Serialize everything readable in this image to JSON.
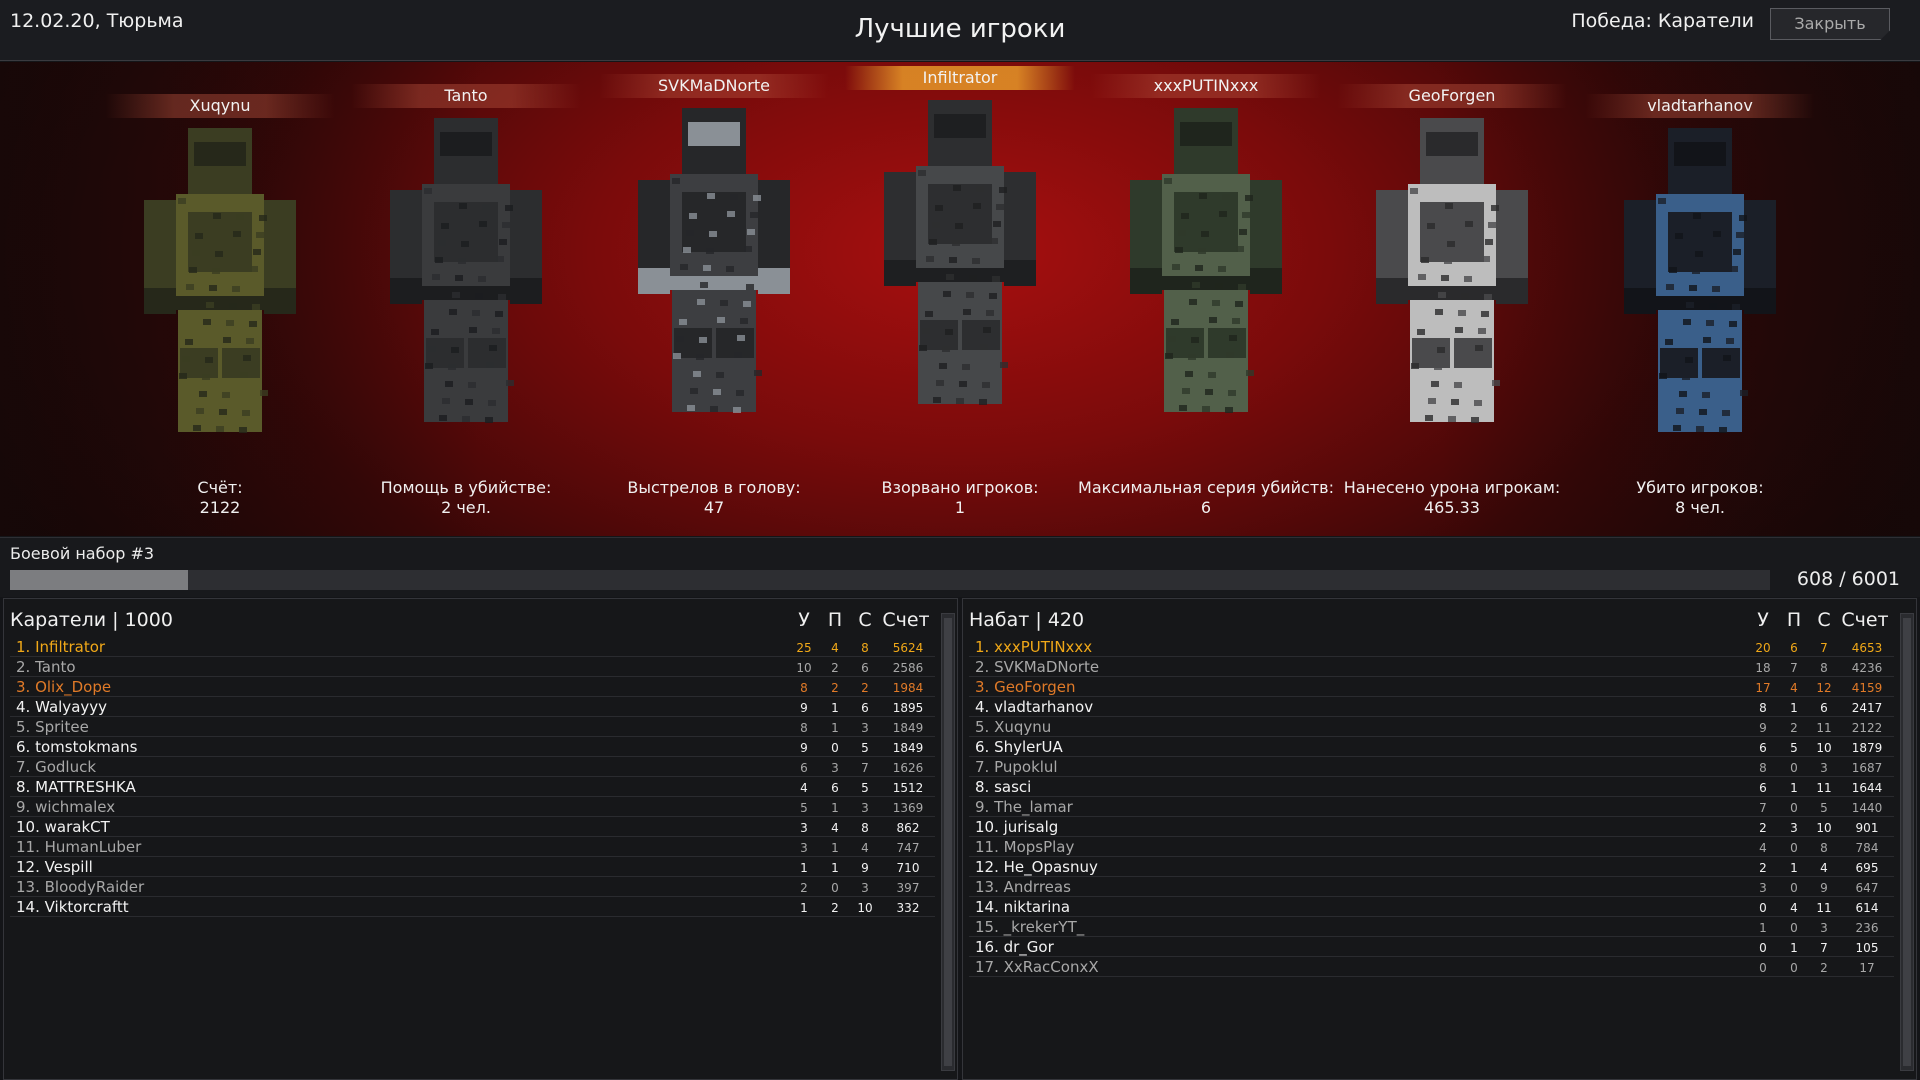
{
  "header": {
    "date_map": "12.02.20, Тюрьма",
    "title": "Лучшие игроки",
    "victory": "Победа: Каратели",
    "close_label": "Закрыть"
  },
  "top_players": [
    {
      "name": "Xuqynu",
      "stat_label": "Счёт:",
      "stat_value": "2122",
      "style": "dim",
      "palette": "camo-olive"
    },
    {
      "name": "Tanto",
      "stat_label": "Помощь в убийстве:",
      "stat_value": "2 чел.",
      "style": "dim",
      "palette": "black"
    },
    {
      "name": "SVKMaDNorte",
      "stat_label": "Выстрелов в голову:",
      "stat_value": "47",
      "style": "dim",
      "palette": "black-gray"
    },
    {
      "name": "Infiltrator",
      "stat_label": "Взорвано игроков:",
      "stat_value": "1",
      "style": "gold",
      "palette": "dark-camo"
    },
    {
      "name": "xxxPUTINxxx",
      "stat_label": "Максимальная серия убийств:",
      "stat_value": "6",
      "style": "dim",
      "palette": "green-camo"
    },
    {
      "name": "GeoForgen",
      "stat_label": "Нанесено урона игрокам:",
      "stat_value": "465.33",
      "style": "dim",
      "palette": "white-camo"
    },
    {
      "name": "vladtarhanov",
      "stat_label": "Убито игроков:",
      "stat_value": "8 чел.",
      "style": "dim",
      "palette": "blue-black"
    }
  ],
  "kit": {
    "label": "Боевой набор #3",
    "count": "608 / 6001",
    "progress": 0.101
  },
  "teams": [
    {
      "name": "Каратели  | 1000",
      "columns": [
        "У",
        "П",
        "С",
        "Счет"
      ],
      "rows": [
        {
          "name": "1. Infiltrator",
          "k": "25",
          "a": "4",
          "d": "8",
          "score": "5624",
          "color": "gold"
        },
        {
          "name": "2. Tanto",
          "k": "10",
          "a": "2",
          "d": "6",
          "score": "2586",
          "color": "grey"
        },
        {
          "name": "3. Olix_Dope",
          "k": "8",
          "a": "2",
          "d": "2",
          "score": "1984",
          "color": "orange"
        },
        {
          "name": "4. Walyayyy",
          "k": "9",
          "a": "1",
          "d": "6",
          "score": "1895",
          "color": "white"
        },
        {
          "name": "5. Spritee",
          "k": "8",
          "a": "1",
          "d": "3",
          "score": "1849",
          "color": "grey"
        },
        {
          "name": "6. tomstokmans",
          "k": "9",
          "a": "0",
          "d": "5",
          "score": "1849",
          "color": "white"
        },
        {
          "name": "7. Godluck",
          "k": "6",
          "a": "3",
          "d": "7",
          "score": "1626",
          "color": "grey"
        },
        {
          "name": "8. MATTRESHKA",
          "k": "4",
          "a": "6",
          "d": "5",
          "score": "1512",
          "color": "white"
        },
        {
          "name": "9. wichmalex",
          "k": "5",
          "a": "1",
          "d": "3",
          "score": "1369",
          "color": "grey"
        },
        {
          "name": "10. warakCT",
          "k": "3",
          "a": "4",
          "d": "8",
          "score": "862",
          "color": "white"
        },
        {
          "name": "11. HumanLuber",
          "k": "3",
          "a": "1",
          "d": "4",
          "score": "747",
          "color": "grey"
        },
        {
          "name": "12. Vespill",
          "k": "1",
          "a": "1",
          "d": "9",
          "score": "710",
          "color": "white"
        },
        {
          "name": "13. BloodyRaider",
          "k": "2",
          "a": "0",
          "d": "3",
          "score": "397",
          "color": "grey"
        },
        {
          "name": "14. Viktorcraftt",
          "k": "1",
          "a": "2",
          "d": "10",
          "score": "332",
          "color": "white"
        }
      ]
    },
    {
      "name": "Набат  | 420",
      "columns": [
        "У",
        "П",
        "С",
        "Счет"
      ],
      "rows": [
        {
          "name": "1. xxxPUTINxxx",
          "k": "20",
          "a": "6",
          "d": "7",
          "score": "4653",
          "color": "gold"
        },
        {
          "name": "2. SVKMaDNorte",
          "k": "18",
          "a": "7",
          "d": "8",
          "score": "4236",
          "color": "grey"
        },
        {
          "name": "3. GeoForgen",
          "k": "17",
          "a": "4",
          "d": "12",
          "score": "4159",
          "color": "orange"
        },
        {
          "name": "4. vladtarhanov",
          "k": "8",
          "a": "1",
          "d": "6",
          "score": "2417",
          "color": "white"
        },
        {
          "name": "5. Xuqynu",
          "k": "9",
          "a": "2",
          "d": "11",
          "score": "2122",
          "color": "grey"
        },
        {
          "name": "6. ShylerUA",
          "k": "6",
          "a": "5",
          "d": "10",
          "score": "1879",
          "color": "white"
        },
        {
          "name": "7. Pupoklul",
          "k": "8",
          "a": "0",
          "d": "3",
          "score": "1687",
          "color": "grey"
        },
        {
          "name": "8. sasci",
          "k": "6",
          "a": "1",
          "d": "11",
          "score": "1644",
          "color": "white"
        },
        {
          "name": "9. The_lamar",
          "k": "7",
          "a": "0",
          "d": "5",
          "score": "1440",
          "color": "grey"
        },
        {
          "name": "10. jurisalg",
          "k": "2",
          "a": "3",
          "d": "10",
          "score": "901",
          "color": "white"
        },
        {
          "name": "11. MopsPlay",
          "k": "4",
          "a": "0",
          "d": "8",
          "score": "784",
          "color": "grey"
        },
        {
          "name": "12. He_Opasnuy",
          "k": "2",
          "a": "1",
          "d": "4",
          "score": "695",
          "color": "white"
        },
        {
          "name": "13. Andrreas",
          "k": "3",
          "a": "0",
          "d": "9",
          "score": "647",
          "color": "grey"
        },
        {
          "name": "14. niktarina",
          "k": "0",
          "a": "4",
          "d": "11",
          "score": "614",
          "color": "white"
        },
        {
          "name": "15. _krekerYT_",
          "k": "1",
          "a": "0",
          "d": "3",
          "score": "236",
          "color": "grey"
        },
        {
          "name": "16. dr_Gor",
          "k": "0",
          "a": "1",
          "d": "7",
          "score": "105",
          "color": "white"
        },
        {
          "name": "17. XxRacConxX",
          "k": "0",
          "a": "0",
          "d": "2",
          "score": "17",
          "color": "grey"
        }
      ]
    }
  ]
}
